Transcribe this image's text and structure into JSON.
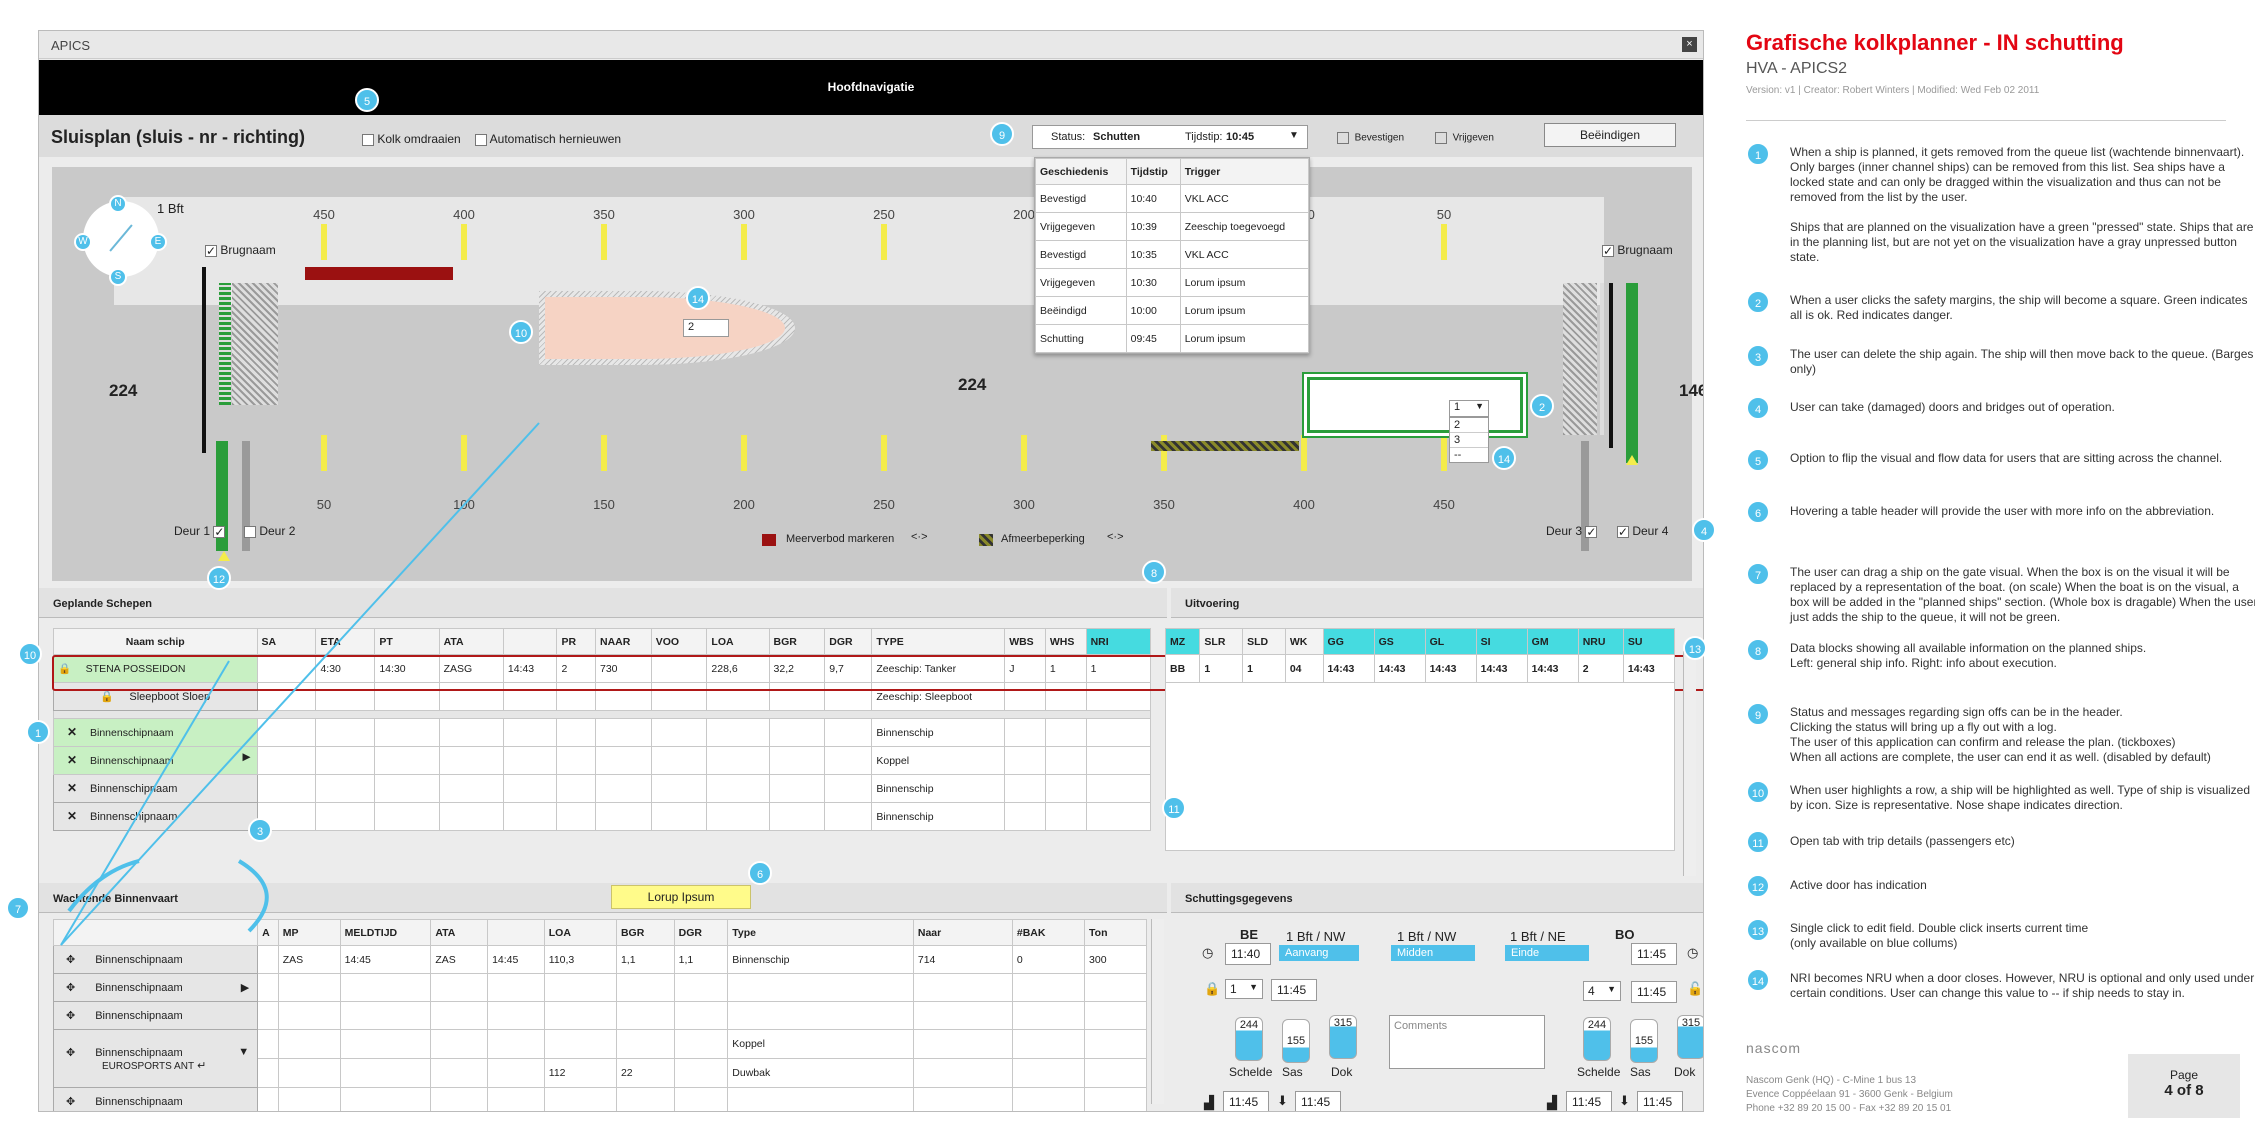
{
  "window": {
    "title": "APICS",
    "close": "×"
  },
  "nav": {
    "title": "Hoofdnavigatie"
  },
  "header": {
    "title": "Sluisplan (sluis - nr - richting)",
    "flip": "Kolk omdraaien",
    "auto": "Automatisch hernieuwen",
    "status_label": "Status:",
    "status_value": "Schutten",
    "time_label": "Tijdstip:",
    "time_value": "10:45",
    "confirm": "Bevestigen",
    "release": "Vrijgeven",
    "end": "Beëindigen"
  },
  "log": {
    "headers": [
      "Geschiedenis",
      "Tijdstip",
      "Trigger"
    ],
    "rows": [
      [
        "Bevestigd",
        "10:40",
        "VKL ACC"
      ],
      [
        "Vrijgegeven",
        "10:39",
        "Zeeschip toegevoegd"
      ],
      [
        "Bevestigd",
        "10:35",
        "VKL ACC"
      ],
      [
        "Vrijgegeven",
        "10:30",
        "Lorum ipsum"
      ],
      [
        "Beëindigd",
        "10:00",
        "Lorum ipsum"
      ],
      [
        "Schutting",
        "09:45",
        "Lorum ipsum"
      ]
    ]
  },
  "viz": {
    "wind": "1 Bft",
    "compass": [
      "N",
      "E",
      "S",
      "W"
    ],
    "bridge_left": "Brugnaam",
    "bridge_right": "Brugnaam",
    "top_scale": [
      "450",
      "400",
      "350",
      "300",
      "250",
      "200",
      "150",
      "100",
      "50"
    ],
    "bottom_scale": [
      "50",
      "100",
      "150",
      "200",
      "250",
      "300",
      "350",
      "400",
      "450"
    ],
    "left_num": "224",
    "mid_num": "224",
    "right_num": "146",
    "ship_value": "2",
    "nri_select": "1",
    "nri_options": [
      "2",
      "3",
      "--"
    ],
    "doors": [
      "Deur 1",
      "Deur 2",
      "Deur 3",
      "Deur 4"
    ],
    "legend_overbid": "Meerverbod markeren",
    "legend_mooring": "Afmeerbeperking",
    "legend_arrow": "<·>"
  },
  "planned": {
    "title": "Geplande Schepen",
    "headers": [
      "Naam schip",
      "SA",
      "ETA",
      "PT",
      "ATA",
      "",
      "PR",
      "NAAR",
      "VOO",
      "LOA",
      "BGR",
      "DGR",
      "TYPE",
      "WBS",
      "WHS",
      "NRI"
    ],
    "rows": [
      {
        "name": "STENA POSSEIDON",
        "cells": [
          "",
          "4:30",
          "14:30",
          "ZASG",
          "14:43",
          "2",
          "730",
          "",
          "228,6",
          "32,2",
          "9,7",
          "Zeeschip: Tanker",
          "J",
          "1",
          "1"
        ]
      },
      {
        "name": "Sleepboot Sloep",
        "cells": [
          "",
          "",
          "",
          "",
          "",
          "",
          "",
          "",
          "",
          "",
          "",
          "Zeeschip: Sleepboot",
          "",
          "",
          ""
        ]
      },
      {
        "name": "Binnenschipnaam",
        "cells": [
          "",
          "",
          "",
          "",
          "",
          "",
          "",
          "",
          "",
          "",
          "",
          "Binnenschip",
          "",
          "",
          ""
        ]
      },
      {
        "name": "Binnenschipnaam",
        "cells": [
          "",
          "",
          "",
          "",
          "",
          "",
          "",
          "",
          "",
          "",
          "",
          "Koppel",
          "",
          "",
          ""
        ]
      },
      {
        "name": "Binnenschipnaam",
        "cells": [
          "",
          "",
          "",
          "",
          "",
          "",
          "",
          "",
          "",
          "",
          "",
          "Binnenschip",
          "",
          "",
          ""
        ]
      },
      {
        "name": "Binnenschipnaam",
        "cells": [
          "",
          "",
          "",
          "",
          "",
          "",
          "",
          "",
          "",
          "",
          "",
          "Binnenschip",
          "",
          "",
          ""
        ]
      }
    ]
  },
  "exec": {
    "title": "Uitvoering",
    "headers": [
      "MZ",
      "SLR",
      "SLD",
      "WK",
      "GG",
      "GS",
      "GL",
      "SI",
      "GM",
      "NRU",
      "SU"
    ],
    "row": [
      "BB",
      "1",
      "1",
      "04",
      "14:43",
      "14:43",
      "14:43",
      "14:43",
      "14:43",
      "2",
      "14:43"
    ]
  },
  "waiting": {
    "title": "Wachtende Binnenvaart",
    "tooltip": "Lorup Ipsum",
    "headers": [
      "",
      "A",
      "MP",
      "MELDTIJD",
      "ATA",
      "",
      "LOA",
      "BGR",
      "DGR",
      "Type",
      "Naar",
      "#BAK",
      "Ton"
    ],
    "rows": [
      {
        "name": "Binnenschipnaam",
        "cells": [
          "",
          "ZAS",
          "14:45",
          "ZAS",
          "14:45",
          "110,3",
          "1,1",
          "1,1",
          "Binnenschip",
          "714",
          "0",
          "300"
        ]
      },
      {
        "name": "Binnenschipnaam",
        "cells": [
          "",
          "",
          "",
          "",
          "",
          "",
          "",
          "",
          "",
          "",
          "",
          ""
        ]
      },
      {
        "name": "Binnenschipnaam",
        "cells": [
          "",
          "",
          "",
          "",
          "",
          "",
          "",
          "",
          "",
          "",
          "",
          ""
        ]
      },
      {
        "name": "Binnenschipnaam",
        "sub": "EUROSPORTS ANT",
        "cells": [
          "",
          "",
          "",
          "",
          "",
          "",
          "",
          "",
          "Koppel",
          "",
          "",
          ""
        ],
        "cells2": [
          "",
          "",
          "",
          "",
          "",
          "112",
          "22",
          "",
          "Duwbak",
          "",
          "",
          ""
        ]
      },
      {
        "name": "Binnenschipnaam",
        "cells": [
          "",
          "",
          "",
          "",
          "",
          "",
          "",
          "",
          "",
          "",
          "",
          ""
        ]
      }
    ]
  },
  "lockdata": {
    "title": "Schuttingsgegevens",
    "be": "BE",
    "bo": "BO",
    "t1": "11:40",
    "t2": "11:45",
    "t3": "11:45",
    "t4": "11:45",
    "sel1": "1",
    "sel2": "4",
    "w1": "1 Bft / NW",
    "w2": "1 Bft / NW",
    "w3": "1 Bft / NE",
    "ph1": "Aanvang",
    "ph2": "Midden",
    "ph3": "Einde",
    "lv": [
      "244",
      "155",
      "315"
    ],
    "rv": [
      "244",
      "155",
      "315"
    ],
    "cols": [
      "Schelde",
      "Sas",
      "Dok"
    ],
    "comments": "Comments",
    "b1": "11:45",
    "b2": "11:45",
    "b3": "11:45",
    "b4": "11:45"
  },
  "doc": {
    "title": "Grafische kolkplanner - IN schutting",
    "sub": "HVA - APICS2",
    "meta": "Version: v1  |  Creator: Robert Winters  |  Modified: Wed Feb 02 2011",
    "notes": [
      "When a ship is planned, it gets removed from the queue list (wachtende binnenvaart). Only barges (inner channel ships) can be removed from this list. Sea ships have a locked state and can only be dragged within the visualization and thus can not be removed from the list by the user.\n\nShips that are planned on the visualization have a green \"pressed\" state. Ships that are in the planning list, but are not yet on the visualization have a gray unpressed button state.",
      "When a user clicks the safety margins, the ship will become a square. Green indicates all is ok. Red indicates danger.",
      "The user can delete the ship again. The ship will then move back to the queue. (Barges only)",
      "User can take (damaged) doors and bridges out of operation.",
      "Option to flip the visual and flow data for users that are sitting across the channel.",
      "Hovering a table header will provide the user with more info on the abbreviation.",
      "The user can drag a ship on the gate visual. When the box is on the visual it will be replaced by a representation of the boat. (on scale) When the boat is on the visual, a box will be added in the \"planned ships\" section. (Whole box is dragable) When the user just adds the ship to the queue, it will not be green.",
      "Data blocks showing all available information on the planned ships.\nLeft: general ship info. Right: info about execution.",
      "Status and messages regarding sign offs can be in the header.\nClicking the status will bring up a fly out with a log.\nThe user of this application can confirm and release the plan. (tickboxes)\nWhen all actions are complete, the user can end it as well. (disabled by default)",
      "When user highlights a row, a ship will be highlighted as well. Type of ship is visualized by icon. Size is representative. Nose shape indicates direction.",
      "Open tab with trip details (passengers etc)",
      "Active door has indication",
      "Single click to edit field. Double click inserts current time\n(only available on blue collums)",
      "NRI becomes NRU when a door closes. However, NRU is optional and only used under certain conditions.  User can change this value to -- if ship needs to stay in."
    ],
    "note_nums": [
      "1",
      "2",
      "3",
      "4",
      "5",
      "6",
      "7",
      "8",
      "9",
      "10",
      "11",
      "12",
      "13",
      "14"
    ],
    "logo": "nascom",
    "footer": [
      "Nascom Genk (HQ)   -   C-Mine 1 bus 13",
      "Evence Coppéelaan 91 - 3600 Genk   -   Belgium",
      "Phone +32 89 20 15 00   -   Fax +32 89 20 15 01"
    ],
    "page_label": "Page",
    "page_num": "4 of 8"
  },
  "markers": [
    "1",
    "2",
    "3",
    "4",
    "5",
    "6",
    "7",
    "8",
    "9",
    "10",
    "11",
    "12",
    "13",
    "14"
  ],
  "colors": {
    "accent": "#4fc0ea",
    "danger": "#9b1111",
    "ok": "#2a9d3a",
    "title_red": "#e30613"
  }
}
